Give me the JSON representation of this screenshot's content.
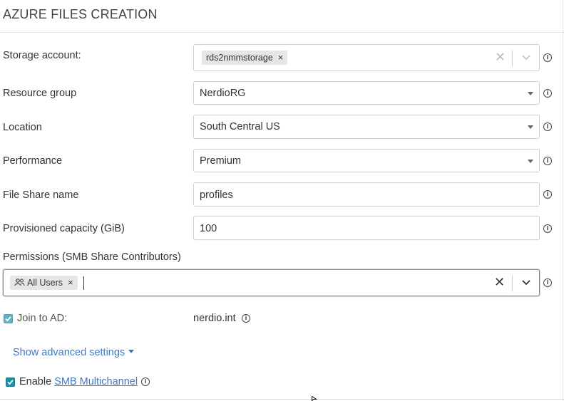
{
  "title": "AZURE FILES CREATION",
  "fields": {
    "storage_account": {
      "label": "Storage account:",
      "tag": "rds2nmmstorage"
    },
    "resource_group": {
      "label": "Resource group",
      "value": "NerdioRG"
    },
    "location": {
      "label": "Location",
      "value": "South Central US"
    },
    "performance": {
      "label": "Performance",
      "value": "Premium"
    },
    "file_share_name": {
      "label": "File Share name",
      "value": "profiles"
    },
    "provisioned_capacity": {
      "label": "Provisioned capacity (GiB)",
      "value": "100"
    },
    "permissions": {
      "label": "Permissions (SMB Share Contributors)",
      "tag": "All Users"
    }
  },
  "join_ad": {
    "label": "Join to AD:",
    "value": "nerdio.int",
    "checked": true
  },
  "advanced": {
    "label": "Show advanced settings"
  },
  "smb": {
    "prefix": "Enable",
    "link": "SMB Multichannel",
    "checked": true
  },
  "icons": {
    "info": "i",
    "remove": "×",
    "clear": "✕",
    "users": "users-icon",
    "check": "✓"
  },
  "colors": {
    "accent": "#3f78c6",
    "checkbox": "#1d8fa7",
    "checkbox_light": "#5cb4c6"
  }
}
